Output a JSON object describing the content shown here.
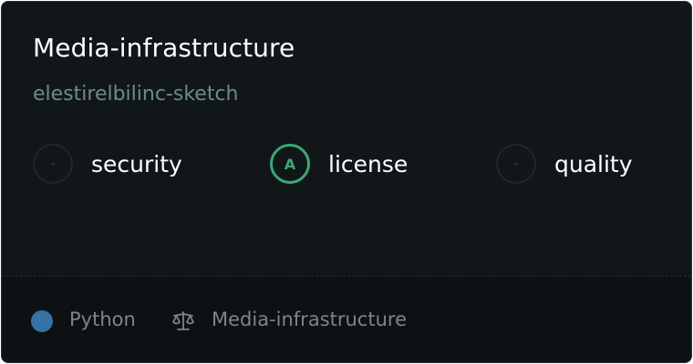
{
  "repo": {
    "name": "Media-infrastructure",
    "owner": "elestirelbilinc-sketch"
  },
  "scores": [
    {
      "grade": "-",
      "label": "security",
      "state": "none"
    },
    {
      "grade": "A",
      "label": "license",
      "state": "good"
    },
    {
      "grade": "-",
      "label": "quality",
      "state": "none"
    }
  ],
  "footer": {
    "language": "Python",
    "language_color": "#3572a5",
    "license": "Media-infrastructure",
    "license_icon": "scale-icon"
  },
  "colors": {
    "good": "#3aa876",
    "background": "#111719"
  }
}
